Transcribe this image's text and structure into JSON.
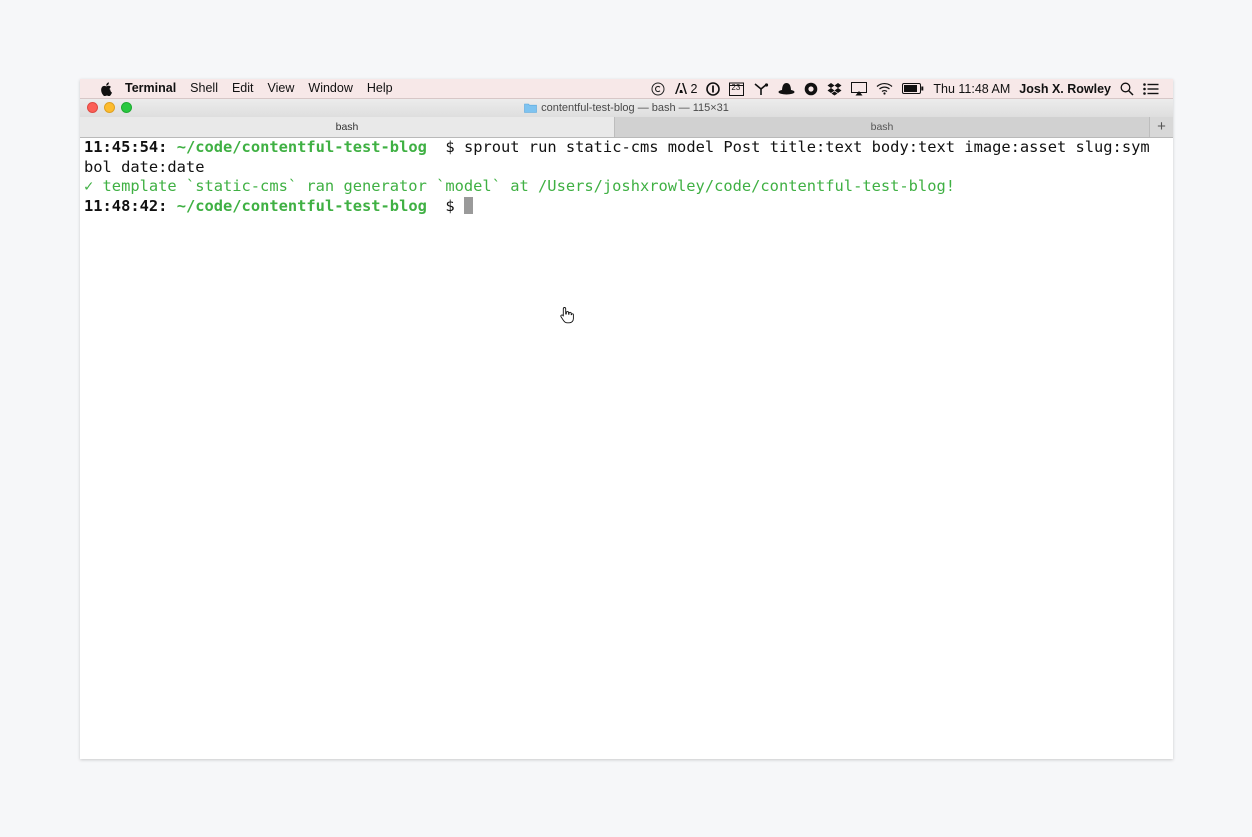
{
  "menubar": {
    "app_name": "Terminal",
    "items": [
      "Shell",
      "Edit",
      "View",
      "Window",
      "Help"
    ],
    "status": {
      "adobe_badge": "2",
      "calendar_day": "23",
      "clock": "Thu 11:48 AM",
      "user": "Josh X. Rowley"
    }
  },
  "window": {
    "title": "contentful-test-blog — bash — 115×31"
  },
  "tabs": [
    {
      "label": "bash",
      "active": true
    },
    {
      "label": "bash",
      "active": false
    }
  ],
  "tab_add_label": "+",
  "terminal": {
    "line1": {
      "time": "11:45:54:",
      "path": "~/code/contentful-test-blog",
      "command": "  $ sprout run static-cms model Post title:text body:text image:asset slug:sym"
    },
    "line2": "bol date:date",
    "line3": "✓ template `static-cms` ran generator `model` at /Users/joshxrowley/code/contentful-test-blog!",
    "line4": {
      "time": "11:48:42:",
      "path": "~/code/contentful-test-blog",
      "prompt": "  $ "
    }
  },
  "colors": {
    "path_green": "#3fb043",
    "menubar_bg": "#f7e8e8"
  }
}
